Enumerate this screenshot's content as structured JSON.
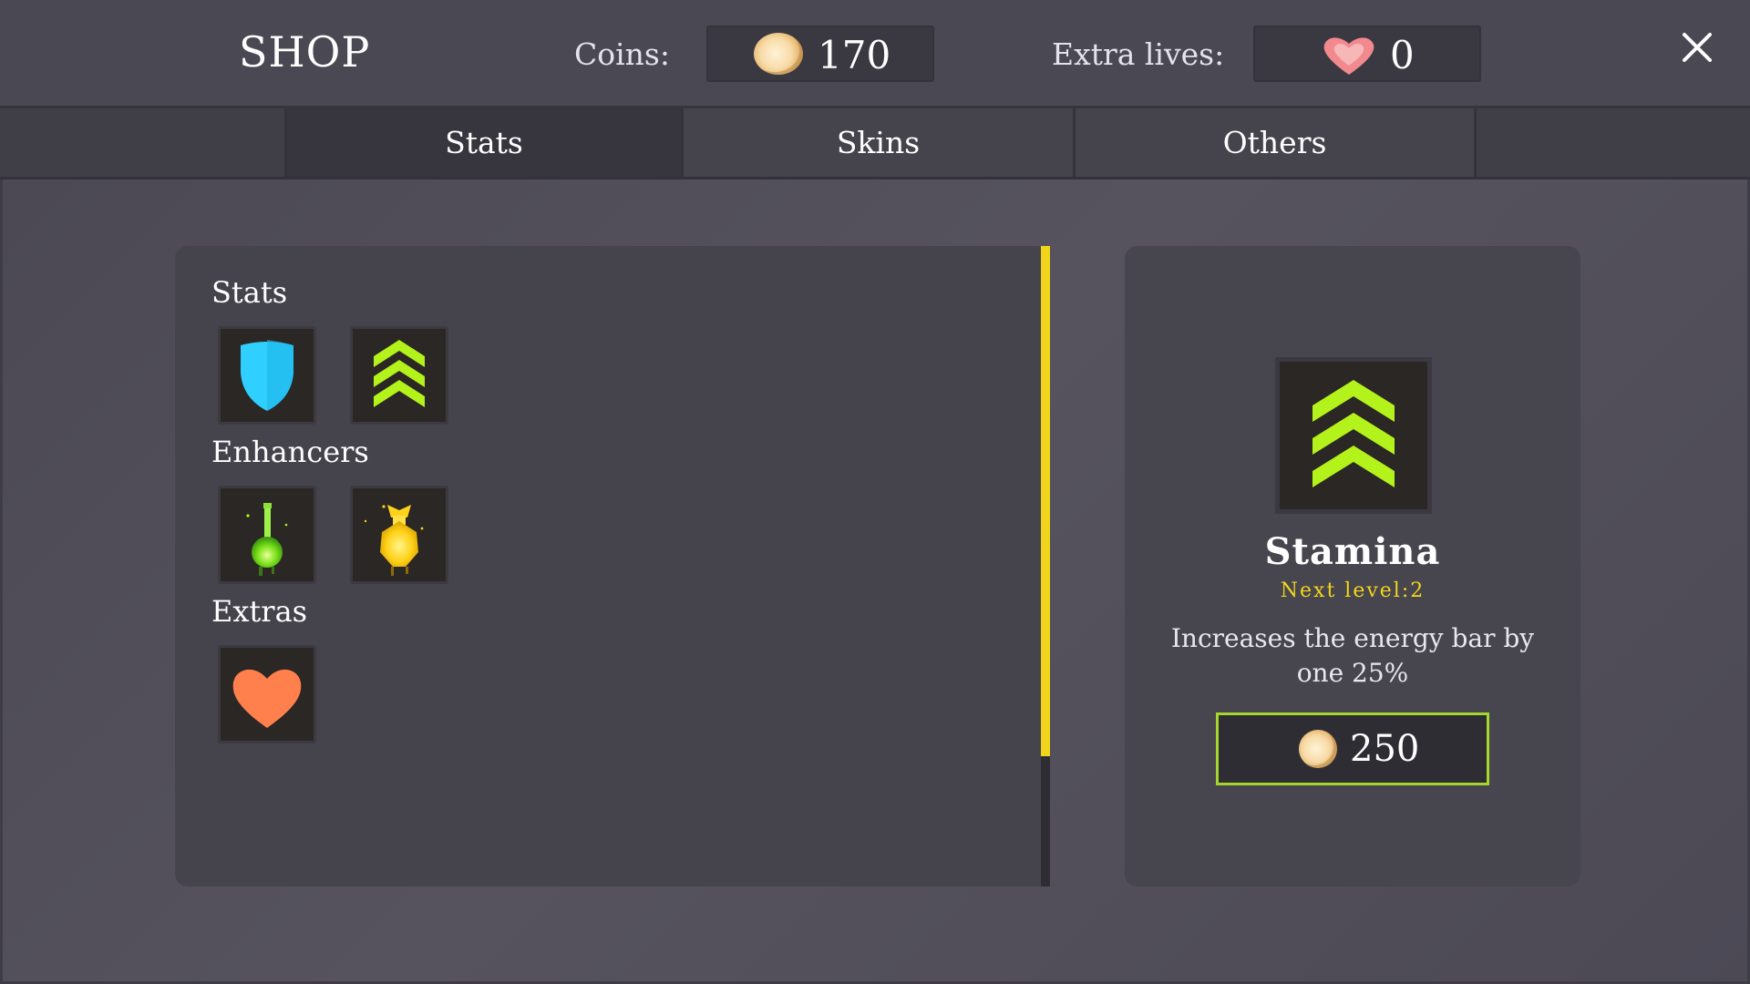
{
  "header": {
    "title": "SHOP",
    "coins_label": "Coins:",
    "coins_value": "170",
    "lives_label": "Extra lives:",
    "lives_value": "0",
    "close_icon": "close-icon"
  },
  "tabs": [
    {
      "label": "Stats",
      "active": true
    },
    {
      "label": "Skins",
      "active": false
    },
    {
      "label": "Others",
      "active": false
    }
  ],
  "catalog": {
    "sections": [
      {
        "title": "Stats",
        "items": [
          {
            "name": "shield",
            "icon": "shield-icon"
          },
          {
            "name": "stamina",
            "icon": "chevrons-up-icon"
          }
        ]
      },
      {
        "title": "Enhancers",
        "items": [
          {
            "name": "green-potion",
            "icon": "green-potion-icon"
          },
          {
            "name": "yellow-potion",
            "icon": "yellow-potion-icon"
          }
        ]
      },
      {
        "title": "Extras",
        "items": [
          {
            "name": "extra-life",
            "icon": "heart-icon"
          }
        ]
      }
    ]
  },
  "detail": {
    "icon": "chevrons-up-icon",
    "name": "Stamina",
    "next_level": "Next level:2",
    "description": "Increases the energy bar by one 25%",
    "price": "250"
  },
  "colors": {
    "accent_yellow": "#f1d51a",
    "chevron_green": "#b4f21c",
    "shield_cyan": "#2fd0ff",
    "heart_orange": "#ff7f4d",
    "buy_border": "#a6d62b"
  }
}
